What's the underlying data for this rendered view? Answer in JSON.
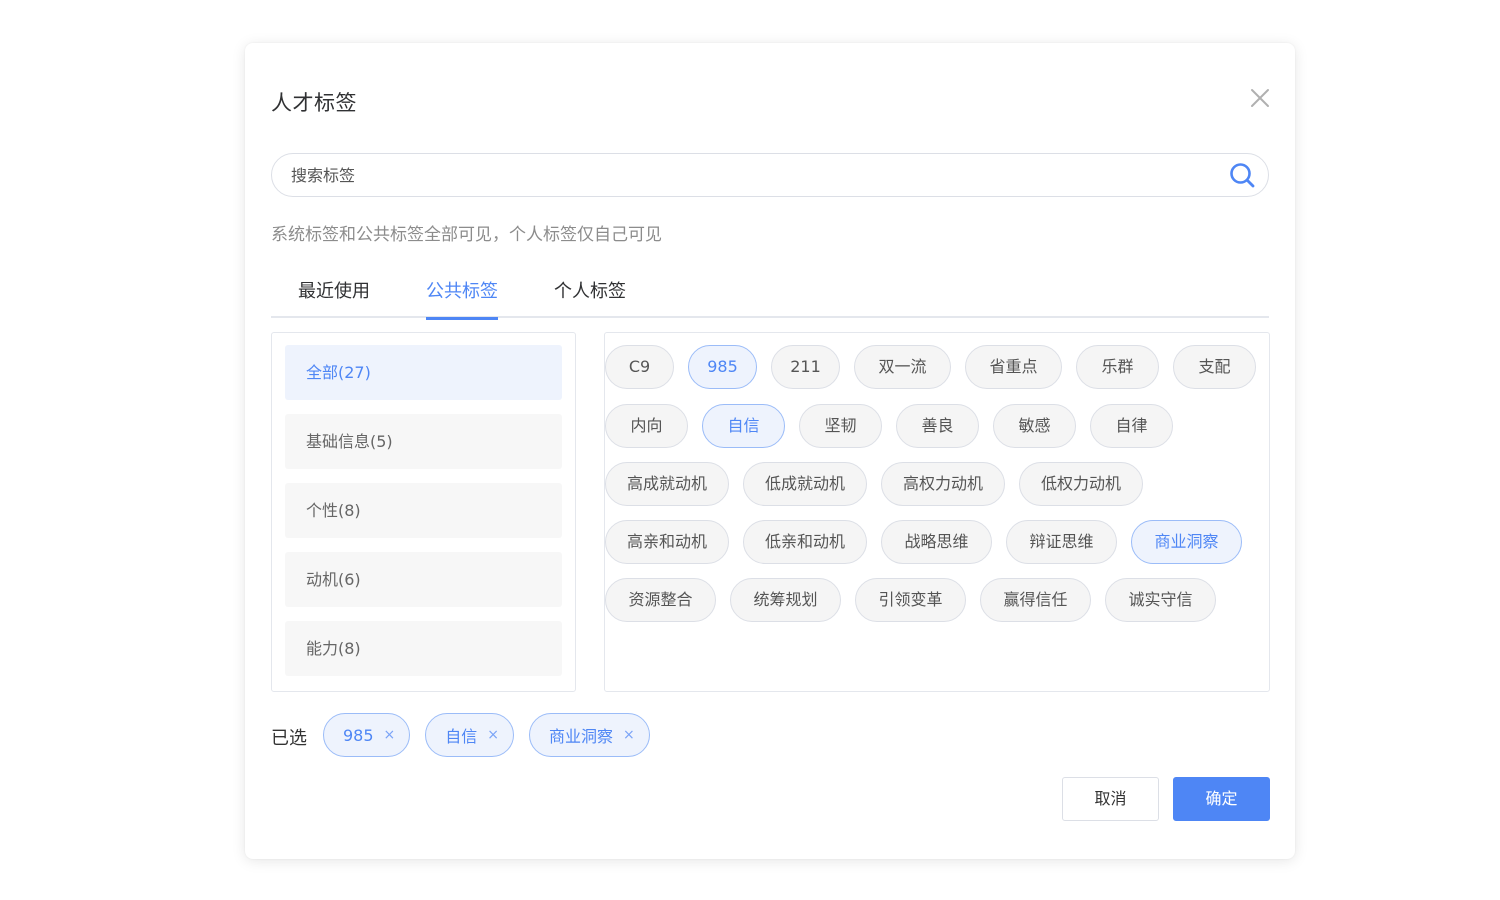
{
  "dialog": {
    "title": "人才标签",
    "search_placeholder": "搜索标签",
    "hint": "系统标签和公共标签全部可见，个人标签仅自己可见",
    "tabs": [
      {
        "label": "最近使用",
        "active": false
      },
      {
        "label": "公共标签",
        "active": true
      },
      {
        "label": "个人标签",
        "active": false
      }
    ],
    "categories": [
      {
        "label": "全部(27)",
        "active": true
      },
      {
        "label": "基础信息(5)",
        "active": false
      },
      {
        "label": "个性(8)",
        "active": false
      },
      {
        "label": "动机(6)",
        "active": false
      },
      {
        "label": "能力(8)",
        "active": false
      }
    ],
    "tag_rows": [
      [
        {
          "label": "C9",
          "selected": false
        },
        {
          "label": "985",
          "selected": true
        },
        {
          "label": "211",
          "selected": false
        },
        {
          "label": "双一流",
          "selected": false
        },
        {
          "label": "省重点",
          "selected": false
        },
        {
          "label": "乐群",
          "selected": false
        },
        {
          "label": "支配",
          "selected": false
        }
      ],
      [
        {
          "label": "内向",
          "selected": false
        },
        {
          "label": "自信",
          "selected": true
        },
        {
          "label": "坚韧",
          "selected": false
        },
        {
          "label": "善良",
          "selected": false
        },
        {
          "label": "敏感",
          "selected": false
        },
        {
          "label": "自律",
          "selected": false
        }
      ],
      [
        {
          "label": "高成就动机",
          "selected": false
        },
        {
          "label": "低成就动机",
          "selected": false
        },
        {
          "label": "高权力动机",
          "selected": false
        },
        {
          "label": "低权力动机",
          "selected": false
        }
      ],
      [
        {
          "label": "高亲和动机",
          "selected": false
        },
        {
          "label": "低亲和动机",
          "selected": false
        },
        {
          "label": "战略思维",
          "selected": false
        },
        {
          "label": "辩证思维",
          "selected": false
        },
        {
          "label": "商业洞察",
          "selected": true
        }
      ],
      [
        {
          "label": "资源整合",
          "selected": false
        },
        {
          "label": "统筹规划",
          "selected": false
        },
        {
          "label": "引领变革",
          "selected": false
        },
        {
          "label": "赢得信任",
          "selected": false
        },
        {
          "label": "诚实守信",
          "selected": false
        }
      ]
    ],
    "selected_label": "已选",
    "selected": [
      "985",
      "自信",
      "商业洞察"
    ],
    "remove_glyph": "×",
    "cancel_label": "取消",
    "confirm_label": "确定"
  },
  "colors": {
    "accent": "#4e86f5",
    "selected_bg": "#eef3fd",
    "tag_bg": "#f5f5f5"
  },
  "icons": {
    "close": "close-icon",
    "search": "search-icon",
    "remove": "remove-icon"
  }
}
